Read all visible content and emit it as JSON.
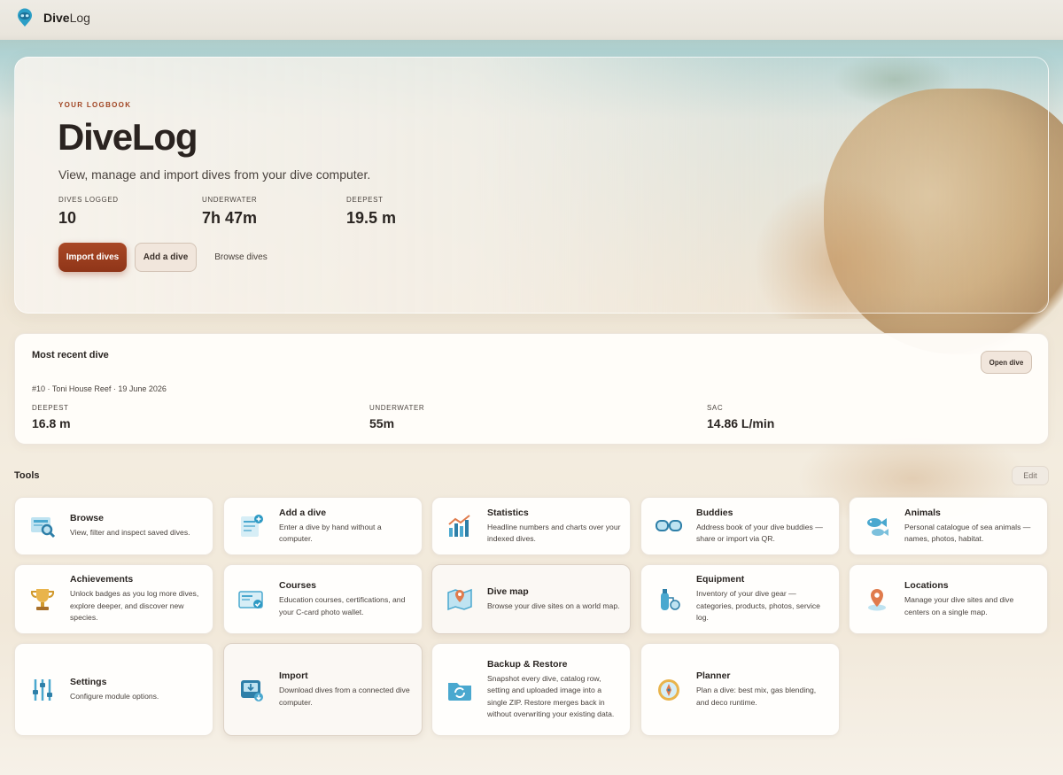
{
  "app": {
    "brand_bold": "Dive",
    "brand_light": "Log"
  },
  "hero": {
    "eyebrow": "YOUR LOGBOOK",
    "title": "DiveLog",
    "subtitle": "View, manage and import dives from your dive computer.",
    "stats": [
      {
        "label": "DIVES LOGGED",
        "value": "10"
      },
      {
        "label": "UNDERWATER",
        "value": "7h 47m"
      },
      {
        "label": "DEEPEST",
        "value": "19.5 m"
      }
    ],
    "buttons": {
      "import": "Import dives",
      "add": "Add a dive",
      "browse": "Browse dives"
    }
  },
  "recent": {
    "title": "Most recent dive",
    "meta": "#10 · Toni House Reef · 19 June 2026",
    "open_label": "Open dive",
    "stats": [
      {
        "label": "DEEPEST",
        "value": "16.8 m"
      },
      {
        "label": "UNDERWATER",
        "value": "55m"
      },
      {
        "label": "SAC",
        "value": "14.86 L/min"
      }
    ]
  },
  "tools": {
    "title": "Tools",
    "edit_label": "Edit",
    "items": [
      {
        "name": "Browse",
        "desc": "View, filter and inspect saved dives.",
        "icon": "browse-icon"
      },
      {
        "name": "Add a dive",
        "desc": "Enter a dive by hand without a computer.",
        "icon": "add-dive-icon"
      },
      {
        "name": "Statistics",
        "desc": "Headline numbers and charts over your indexed dives.",
        "icon": "statistics-icon"
      },
      {
        "name": "Buddies",
        "desc": "Address book of your dive buddies — share or import via QR.",
        "icon": "buddies-icon"
      },
      {
        "name": "Animals",
        "desc": "Personal catalogue of sea animals — names, photos, habitat.",
        "icon": "animals-icon"
      },
      {
        "name": "Achievements",
        "desc": "Unlock badges as you log more dives, explore deeper, and discover new species.",
        "icon": "trophy-icon"
      },
      {
        "name": "Courses",
        "desc": "Education courses, certifications, and your C-card photo wallet.",
        "icon": "certificate-icon"
      },
      {
        "name": "Dive map",
        "desc": "Browse your dive sites on a world map.",
        "icon": "map-icon"
      },
      {
        "name": "Equipment",
        "desc": "Inventory of your dive gear — categories, products, photos, service log.",
        "icon": "tank-icon"
      },
      {
        "name": "Locations",
        "desc": "Manage your dive sites and dive centers on a single map.",
        "icon": "location-pin-icon"
      },
      {
        "name": "Settings",
        "desc": "Configure module options.",
        "icon": "sliders-icon"
      },
      {
        "name": "Import",
        "desc": "Download dives from a connected dive computer.",
        "icon": "download-icon"
      },
      {
        "name": "Backup & Restore",
        "desc": "Snapshot every dive, catalog row, setting and uploaded image into a single ZIP. Restore merges back in without overwriting your existing data.",
        "icon": "backup-icon"
      },
      {
        "name": "Planner",
        "desc": "Plan a dive: best mix, gas blending, and deco runtime.",
        "icon": "compass-icon"
      }
    ]
  }
}
